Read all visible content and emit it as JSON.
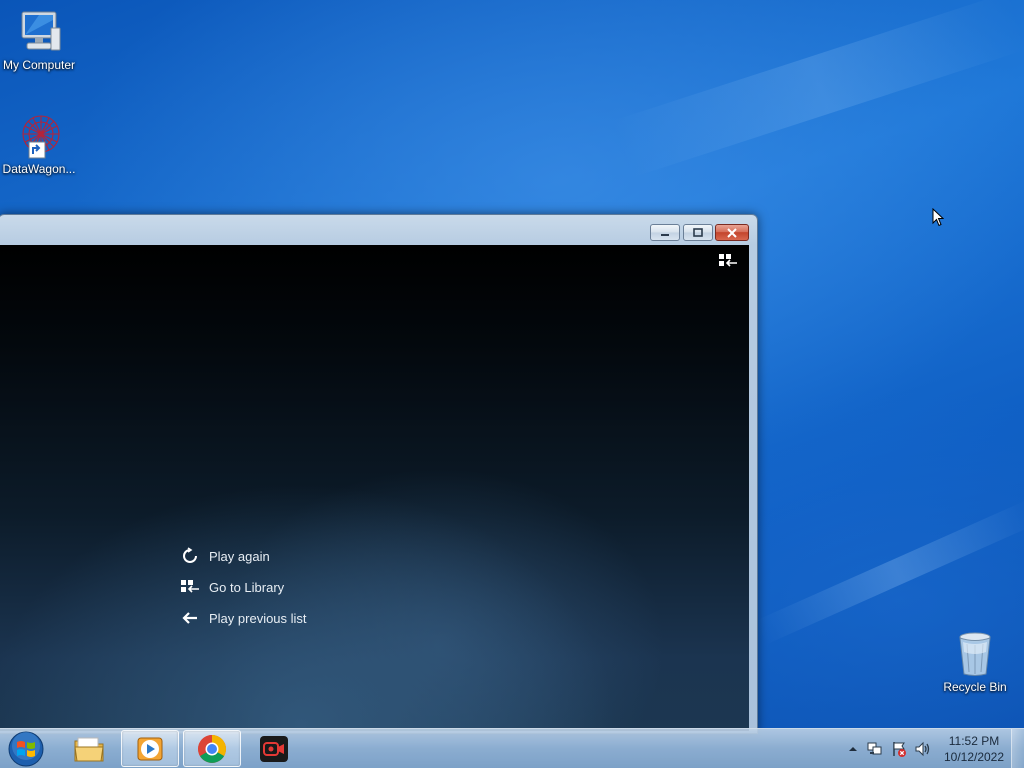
{
  "desktop": {
    "icons": [
      {
        "label": "My Computer",
        "icon": "my-computer-icon"
      },
      {
        "label": "DataWagon...",
        "icon": "datawagon-shortcut-icon"
      },
      {
        "label": "Recycle Bin",
        "icon": "recycle-bin-icon"
      }
    ]
  },
  "window": {
    "title_buttons": {
      "minimize": "minimize-icon",
      "maximize": "maximize-icon",
      "close": "close-icon"
    },
    "player": {
      "switch_icon": "switch-to-library-icon",
      "menu": [
        {
          "label": "Play again",
          "icon": "replay-icon"
        },
        {
          "label": "Go to Library",
          "icon": "library-icon"
        },
        {
          "label": "Play previous list",
          "icon": "back-arrow-icon"
        }
      ]
    }
  },
  "taskbar": {
    "start_icon": "windows-start-icon",
    "apps": [
      {
        "name": "File Explorer",
        "icon": "folder-icon",
        "active": false
      },
      {
        "name": "Windows Media Player",
        "icon": "media-player-icon",
        "active": true
      },
      {
        "name": "Google Chrome",
        "icon": "chrome-icon",
        "active": true
      },
      {
        "name": "Screen Recorder",
        "icon": "video-recorder-icon",
        "active": false
      }
    ],
    "tray": {
      "icons": [
        "show-hidden-icons-icon",
        "network-icon",
        "action-center-icon",
        "volume-icon"
      ],
      "time": "11:52 PM",
      "date": "10/12/2022"
    }
  },
  "colors": {
    "desktop_blue": "#1f78d8",
    "close_red": "#c3442c",
    "player_bg": "#0c1b29"
  }
}
